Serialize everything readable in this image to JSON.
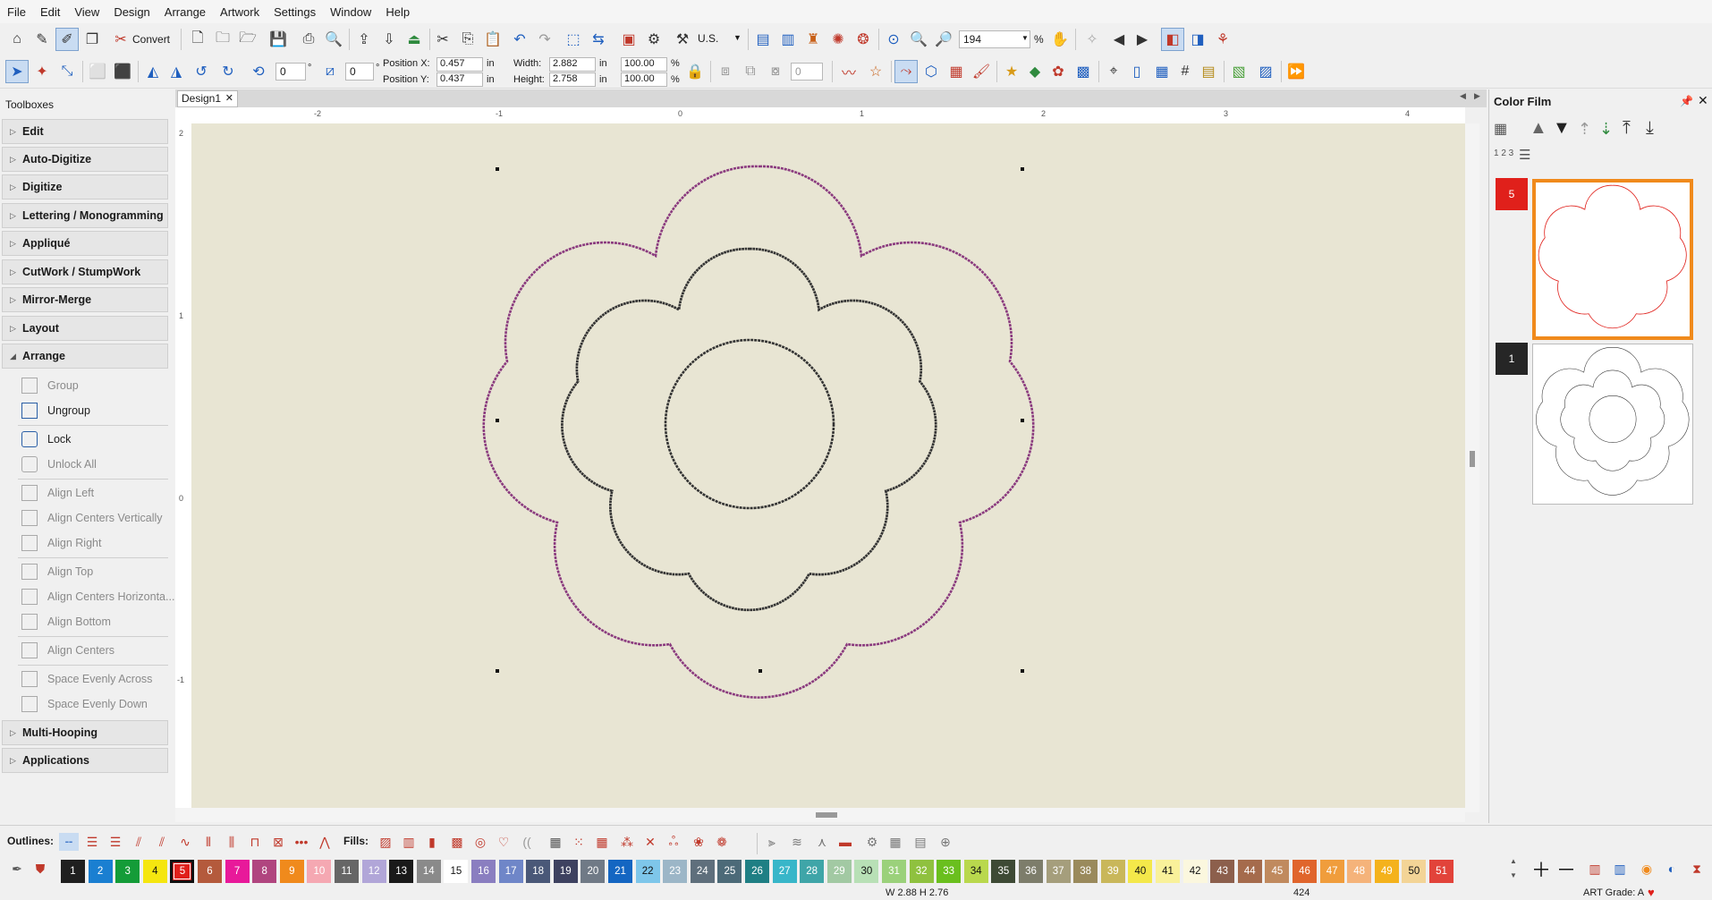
{
  "menu": [
    "File",
    "Edit",
    "View",
    "Design",
    "Arrange",
    "Artwork",
    "Settings",
    "Window",
    "Help"
  ],
  "toolbar1": {
    "convert_label": "Convert",
    "units_value": "U.S.",
    "zoom_value": "194",
    "zoom_unit": "%"
  },
  "toolbar2": {
    "rotate_value": "0",
    "skew_value": "0",
    "degree": "°",
    "pos_x_label": "Position X:",
    "pos_x_value": "0.457",
    "pos_y_label": "Position Y:",
    "pos_y_value": "0.437",
    "width_label": "Width:",
    "width_value": "2.882",
    "height_label": "Height:",
    "height_value": "2.758",
    "unit": "in",
    "scale_w": "100.00",
    "scale_h": "100.00",
    "percent": "%",
    "count_value": "0"
  },
  "toolboxes": {
    "title": "Toolboxes",
    "headers": [
      "Edit",
      "Auto-Digitize",
      "Digitize",
      "Lettering / Monogramming",
      "Appliqué",
      "CutWork / StumpWork",
      "Mirror-Merge",
      "Layout",
      "Arrange"
    ],
    "arrange_items": [
      "Group",
      "Ungroup",
      "Lock",
      "Unlock All",
      "Align Left",
      "Align Centers Vertically",
      "Align Right",
      "Align Top",
      "Align Centers Horizonta...",
      "Align Bottom",
      "Align Centers",
      "Space Evenly Across",
      "Space Evenly Down"
    ],
    "footer_headers": [
      "Multi-Hooping",
      "Applications"
    ]
  },
  "design_tab": {
    "label": "Design1",
    "close": "✕"
  },
  "ruler": {
    "h_ticks": [
      "-2",
      "-1",
      "0",
      "1",
      "2",
      "3",
      "4"
    ],
    "v_ticks": [
      "2",
      "1",
      "0",
      "-1"
    ]
  },
  "color_film": {
    "title": "Color Film",
    "number_row_label": "1 2 3",
    "entries": [
      {
        "number": "5",
        "color": "#e0201b"
      },
      {
        "number": "1",
        "color": "#262626"
      }
    ]
  },
  "outlines_label": "Outlines:",
  "fills_label": "Fills:",
  "palette": [
    {
      "n": "1",
      "c": "#1f1f1f",
      "t": "#ffffff"
    },
    {
      "n": "2",
      "c": "#1a7fd1",
      "t": "#ffffff"
    },
    {
      "n": "3",
      "c": "#149c38",
      "t": "#ffffff"
    },
    {
      "n": "4",
      "c": "#f5e60f",
      "t": "#111111"
    },
    {
      "n": "5",
      "c": "#e0201b",
      "t": "#ffffff"
    },
    {
      "n": "6",
      "c": "#b45a3c",
      "t": "#ffffff"
    },
    {
      "n": "7",
      "c": "#e8199a",
      "t": "#ffffff"
    },
    {
      "n": "8",
      "c": "#b0457f",
      "t": "#ffffff"
    },
    {
      "n": "9",
      "c": "#f08a1c",
      "t": "#ffffff"
    },
    {
      "n": "10",
      "c": "#f5a8b2",
      "t": "#ffffff"
    },
    {
      "n": "11",
      "c": "#666666",
      "t": "#ffffff"
    },
    {
      "n": "12",
      "c": "#b1a6d8",
      "t": "#ffffff"
    },
    {
      "n": "13",
      "c": "#1a1a1a",
      "t": "#ffffff"
    },
    {
      "n": "14",
      "c": "#8a8a8a",
      "t": "#ffffff"
    },
    {
      "n": "15",
      "c": "#ffffff",
      "t": "#111111"
    },
    {
      "n": "16",
      "c": "#8a7ec0",
      "t": "#ffffff"
    },
    {
      "n": "17",
      "c": "#6f86c8",
      "t": "#ffffff"
    },
    {
      "n": "18",
      "c": "#4a5878",
      "t": "#ffffff"
    },
    {
      "n": "19",
      "c": "#3e4260",
      "t": "#ffffff"
    },
    {
      "n": "20",
      "c": "#707a86",
      "t": "#ffffff"
    },
    {
      "n": "21",
      "c": "#1466c2",
      "t": "#ffffff"
    },
    {
      "n": "22",
      "c": "#7ec6ea",
      "t": "#111111"
    },
    {
      "n": "23",
      "c": "#9cb6c7",
      "t": "#ffffff"
    },
    {
      "n": "24",
      "c": "#5f6f7c",
      "t": "#ffffff"
    },
    {
      "n": "25",
      "c": "#4c6a78",
      "t": "#ffffff"
    },
    {
      "n": "26",
      "c": "#1f7f84",
      "t": "#ffffff"
    },
    {
      "n": "27",
      "c": "#38b6c9",
      "t": "#ffffff"
    },
    {
      "n": "28",
      "c": "#3fa5a8",
      "t": "#ffffff"
    },
    {
      "n": "29",
      "c": "#a2c9a3",
      "t": "#ffffff"
    },
    {
      "n": "30",
      "c": "#b8e0b6",
      "t": "#111111"
    },
    {
      "n": "31",
      "c": "#9bd17b",
      "t": "#ffffff"
    },
    {
      "n": "32",
      "c": "#8fc13f",
      "t": "#ffffff"
    },
    {
      "n": "33",
      "c": "#6abf1e",
      "t": "#ffffff"
    },
    {
      "n": "34",
      "c": "#b9d84d",
      "t": "#111111"
    },
    {
      "n": "35",
      "c": "#3e4a35",
      "t": "#ffffff"
    },
    {
      "n": "36",
      "c": "#7d7d6b",
      "t": "#ffffff"
    },
    {
      "n": "37",
      "c": "#a59e7c",
      "t": "#ffffff"
    },
    {
      "n": "38",
      "c": "#9a8a5c",
      "t": "#ffffff"
    },
    {
      "n": "39",
      "c": "#c9b75a",
      "t": "#ffffff"
    },
    {
      "n": "40",
      "c": "#f4e84a",
      "t": "#111111"
    },
    {
      "n": "41",
      "c": "#f9f19a",
      "t": "#111111"
    },
    {
      "n": "42",
      "c": "#fbf7de",
      "t": "#111111"
    },
    {
      "n": "43",
      "c": "#8c5f4c",
      "t": "#ffffff"
    },
    {
      "n": "44",
      "c": "#a56b4c",
      "t": "#ffffff"
    },
    {
      "n": "45",
      "c": "#c08a5e",
      "t": "#ffffff"
    },
    {
      "n": "46",
      "c": "#e0652c",
      "t": "#ffffff"
    },
    {
      "n": "47",
      "c": "#f09d3c",
      "t": "#ffffff"
    },
    {
      "n": "48",
      "c": "#f5b37a",
      "t": "#ffffff"
    },
    {
      "n": "49",
      "c": "#f4b21c",
      "t": "#ffffff"
    },
    {
      "n": "50",
      "c": "#f3d496",
      "t": "#111111"
    },
    {
      "n": "51",
      "c": "#e2433a",
      "t": "#ffffff"
    }
  ],
  "status": {
    "size": "W 2.88 H 2.76",
    "stitches": "424",
    "art_grade": "ART Grade: A",
    "heart": "♥"
  }
}
